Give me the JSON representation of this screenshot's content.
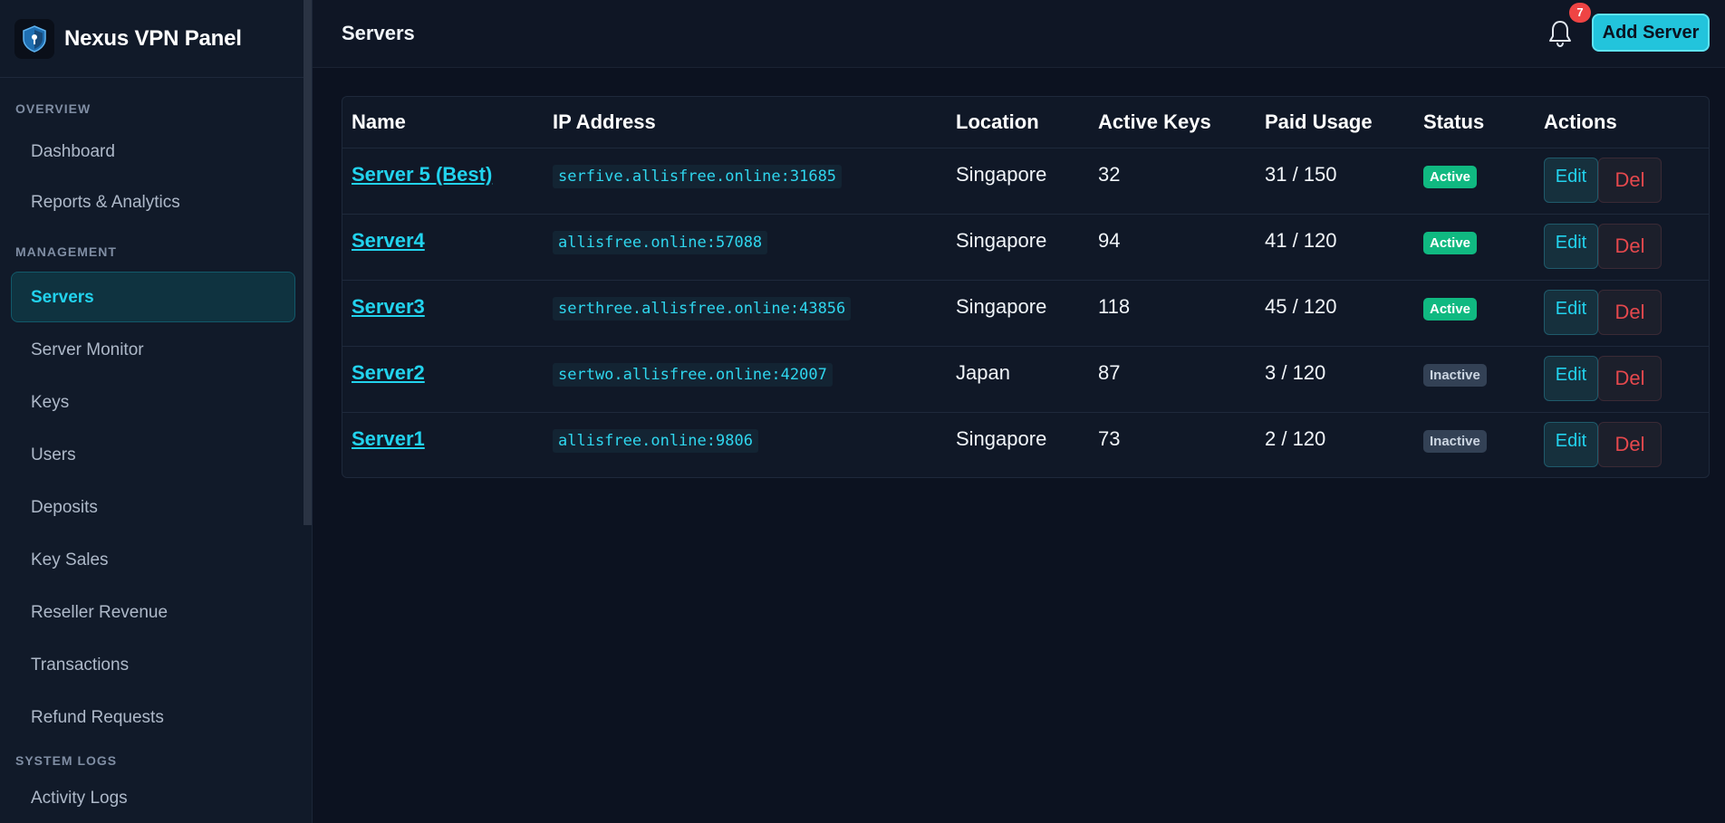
{
  "brand": {
    "title": "Nexus VPN Panel"
  },
  "sidebar": {
    "sections": [
      {
        "label": "OVERVIEW",
        "items": [
          {
            "label": "Dashboard",
            "active": false
          },
          {
            "label": "Reports & Analytics",
            "active": false
          }
        ]
      },
      {
        "label": "MANAGEMENT",
        "items": [
          {
            "label": "Servers",
            "active": true
          },
          {
            "label": "Server Monitor",
            "active": false
          },
          {
            "label": "Keys",
            "active": false
          },
          {
            "label": "Users",
            "active": false
          },
          {
            "label": "Deposits",
            "active": false
          },
          {
            "label": "Key Sales",
            "active": false
          },
          {
            "label": "Reseller Revenue",
            "active": false
          },
          {
            "label": "Transactions",
            "active": false
          },
          {
            "label": "Refund Requests",
            "active": false
          }
        ]
      },
      {
        "label": "SYSTEM LOGS",
        "items": [
          {
            "label": "Activity Logs",
            "active": false
          }
        ]
      }
    ]
  },
  "header": {
    "title": "Servers",
    "notification_count": "7",
    "add_button_label": "Add Server"
  },
  "table": {
    "columns": [
      "Name",
      "IP Address",
      "Location",
      "Active Keys",
      "Paid Usage",
      "Status",
      "Actions"
    ],
    "rows": [
      {
        "name": "Server 5 (Best)",
        "ip": "serfive.allisfree.online:31685",
        "location": "Singapore",
        "active_keys": "32",
        "paid_usage": "31 / 150",
        "status": "Active"
      },
      {
        "name": "Server4",
        "ip": "allisfree.online:57088",
        "location": "Singapore",
        "active_keys": "94",
        "paid_usage": "41 / 120",
        "status": "Active"
      },
      {
        "name": "Server3",
        "ip": "serthree.allisfree.online:43856",
        "location": "Singapore",
        "active_keys": "118",
        "paid_usage": "45 / 120",
        "status": "Active"
      },
      {
        "name": "Server2",
        "ip": "sertwo.allisfree.online:42007",
        "location": "Japan",
        "active_keys": "87",
        "paid_usage": "3 / 120",
        "status": "Inactive"
      },
      {
        "name": "Server1",
        "ip": "allisfree.online:9806",
        "location": "Singapore",
        "active_keys": "73",
        "paid_usage": "2 / 120",
        "status": "Inactive"
      }
    ],
    "edit_label": "Edit",
    "delete_label": "Del"
  },
  "colors": {
    "accent": "#22d3ee",
    "active_status": "#10b981",
    "inactive_status": "#334155",
    "danger": "#e5484d",
    "notification": "#ef4444"
  }
}
